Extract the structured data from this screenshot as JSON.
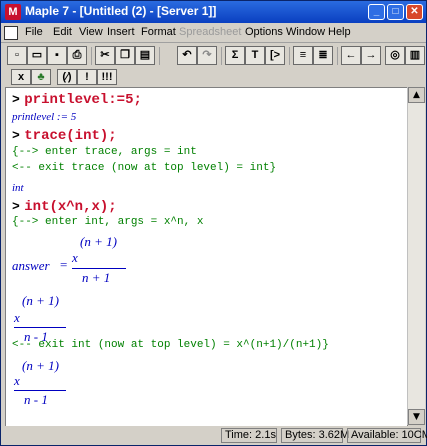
{
  "window": {
    "title": "Maple 7 - [Untitled (2) - [Server 1]]"
  },
  "menu": [
    {
      "label": "File",
      "disabled": false
    },
    {
      "label": "Edit",
      "disabled": false
    },
    {
      "label": "View",
      "disabled": false
    },
    {
      "label": "Insert",
      "disabled": false
    },
    {
      "label": "Format",
      "disabled": false
    },
    {
      "label": "Spreadsheet",
      "disabled": true
    },
    {
      "label": "Options",
      "disabled": false
    },
    {
      "label": "Window",
      "disabled": false
    },
    {
      "label": "Help",
      "disabled": false
    }
  ],
  "toolbar1": {
    "icons": [
      "new-icon",
      "open-icon",
      "save-icon",
      "print-icon",
      "cut-icon",
      "copy-icon",
      "paste-icon",
      "undo-icon",
      "redo-icon",
      "sum-icon",
      "text-icon",
      "t-bracket-icon",
      "execute-group-icon",
      "execute-all-icon",
      "back-arrow-icon",
      "forward-arrow-icon",
      "stop-icon",
      "restart-icon"
    ],
    "glyphs": {
      "sum": "Σ",
      "text": "T",
      "t_bracket": "[>",
      "back": "←",
      "forward": "→"
    }
  },
  "toolbar2": {
    "glyphs": [
      "x",
      "♣",
      "(⁄)",
      "!",
      "!!!"
    ]
  },
  "worksheet": {
    "prompt": ">",
    "cmd1": "printlevel:=5;",
    "out1": "printlevel := 5",
    "cmd2": "trace(int);",
    "trace1": "{--> enter trace, args = int",
    "trace2": "<-- exit trace (now at top level) = int}",
    "out2": "int",
    "cmd3": "int(x^n,x);",
    "trace3": "{--> enter int, args = x^n, x",
    "answer_label": "answer",
    "equals": "=",
    "frac1_num_base": "x",
    "frac1_num_exp": "(n + 1)",
    "frac1_den": "n + 1",
    "frac2_num_base": "x",
    "frac2_num_exp": "(n + 1)",
    "frac2_den": "n - 1",
    "trace4": "<-- exit int (now at top level) = x^(n+1)/(n+1)}",
    "frac3_num_base": "x",
    "frac3_num_exp": "(n + 1)",
    "frac3_den": "n - 1"
  },
  "status": {
    "time": "Time: 2.1s",
    "bytes": "Bytes: 3.62M",
    "available": "Available: 10CM"
  }
}
